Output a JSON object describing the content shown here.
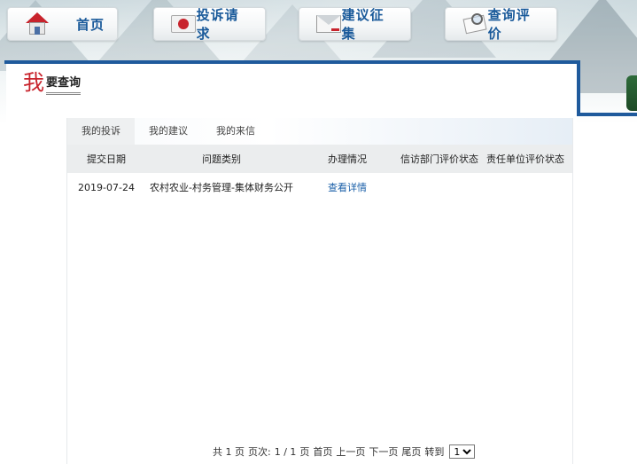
{
  "nav": {
    "home_label": "首页",
    "complaint_label": "投诉请求",
    "suggestion_label": "建议征集",
    "query_label": "查询评价",
    "icons": [
      "home-icon",
      "complaint-envelope-icon",
      "suggestion-envelope-icon",
      "query-document-icon"
    ]
  },
  "page_title": {
    "big_char": "我",
    "rest": "要查询"
  },
  "tabs": [
    {
      "label": "我的投诉",
      "active": true
    },
    {
      "label": "我的建议",
      "active": false
    },
    {
      "label": "我的来信",
      "active": false
    }
  ],
  "table": {
    "headers": [
      "提交日期",
      "问题类别",
      "办理情况",
      "信访部门评价状态",
      "责任单位评价状态"
    ],
    "rows": [
      {
        "date": "2019-07-24",
        "category": "农村农业-村务管理-集体财务公开",
        "status_link": "查看详情",
        "petition_eval": "",
        "unit_eval": ""
      }
    ]
  },
  "pager": {
    "total_text": "共 1 页",
    "page_label": "页次:",
    "page_value": "1 / 1",
    "page_unit": "页",
    "first": "首页",
    "prev": "上一页",
    "next": "下一页",
    "last": "尾页",
    "goto": "转到",
    "selected": "1"
  },
  "colors": {
    "accent_blue": "#1f5a9c",
    "nav_text": "#1a5a9a",
    "title_red": "#c8232c",
    "link": "#1a5fa8"
  }
}
